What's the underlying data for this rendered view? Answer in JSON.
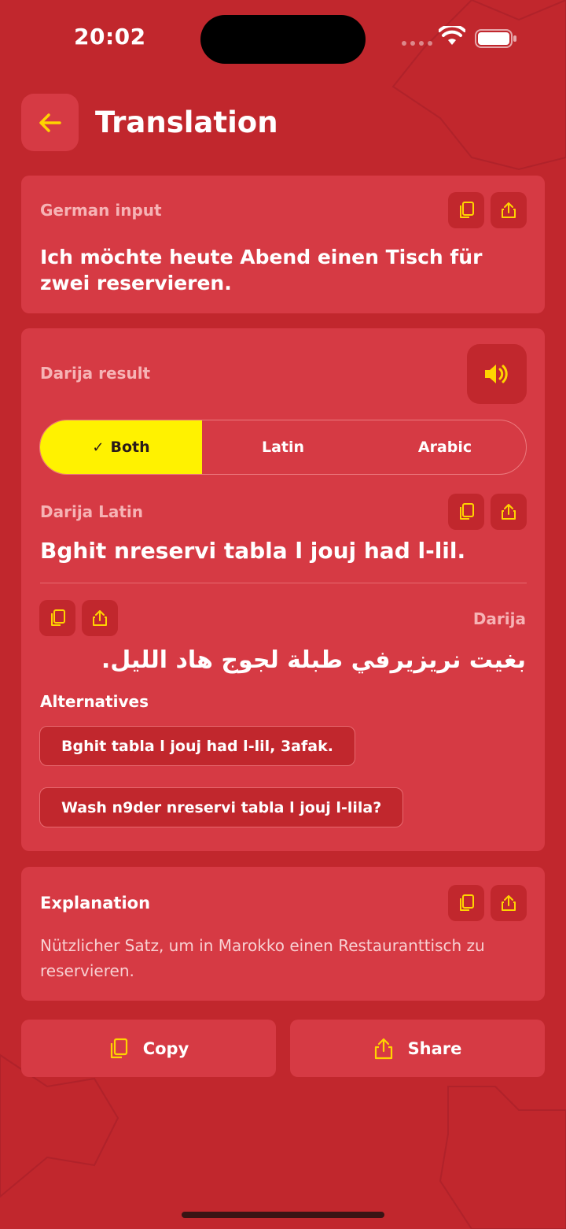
{
  "status": {
    "time": "20:02"
  },
  "header": {
    "title": "Translation"
  },
  "input_card": {
    "label": "German input",
    "text": "Ich möchte heute Abend einen Tisch für zwei reservieren."
  },
  "result_card": {
    "label": "Darija result",
    "segments": [
      {
        "label": "Both",
        "selected": true
      },
      {
        "label": "Latin",
        "selected": false
      },
      {
        "label": "Arabic",
        "selected": false
      }
    ],
    "latin_label": "Darija Latin",
    "latin_text": "Bghit nreservi tabla l jouj had l-lil.",
    "arabic_label": "Darija",
    "arabic_text": "بغيت نريزيرفي طبلة لجوج هاد الليل.",
    "alternatives_title": "Alternatives",
    "alternatives": [
      "Bghit tabla l jouj had l-lil, 3afak.",
      "Wash n9der nreservi tabla l jouj l-lila?"
    ]
  },
  "explanation_card": {
    "title": "Explanation",
    "text": "Nützlicher Satz, um in Marokko einen Restauranttisch zu reservieren."
  },
  "actions": {
    "copy_label": "Copy",
    "share_label": "Share"
  },
  "colors": {
    "background": "#c1272d",
    "card": "#d63a44",
    "accent": "#fff200",
    "icon": "#ffd400"
  },
  "icons": [
    "back-arrow-icon",
    "copy-icon",
    "share-icon",
    "speaker-icon",
    "check-icon",
    "wifi-icon",
    "battery-icon"
  ]
}
